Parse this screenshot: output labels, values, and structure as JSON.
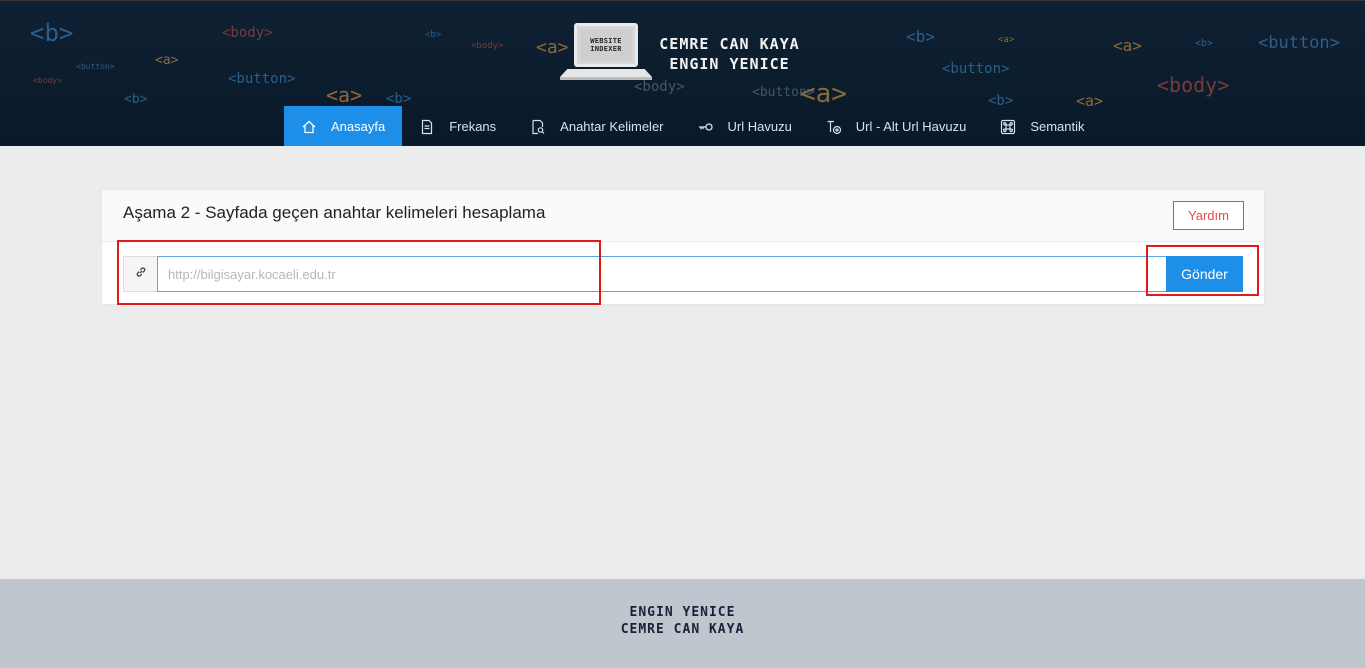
{
  "header": {
    "logo_text": [
      "WEBSITE",
      "INDEXER"
    ],
    "brand_line1": "CEMRE CAN KAYA",
    "brand_line2": "ENGIN YENICE",
    "background_tags": [
      "<b>",
      "<body>",
      "<button>",
      "<a>",
      "<b>",
      "<body>",
      "<a>",
      "<b>",
      "<button>",
      "<body>",
      "<a>",
      "<b>",
      "<button>",
      "<a>",
      "<body>",
      "<b>",
      "<a>",
      "<button>",
      "<b>",
      "<a>",
      "<body>",
      "<a>"
    ]
  },
  "nav": {
    "items": [
      {
        "label": "Anasayfa",
        "icon": "home-icon",
        "active": true
      },
      {
        "label": "Frekans",
        "icon": "document-icon",
        "active": false
      },
      {
        "label": "Anahtar Kelimeler",
        "icon": "document-search-icon",
        "active": false
      },
      {
        "label": "Url Havuzu",
        "icon": "key-icon",
        "active": false
      },
      {
        "label": "Url - Alt Url Havuzu",
        "icon": "tree-add-icon",
        "active": false
      },
      {
        "label": "Semantik",
        "icon": "command-icon",
        "active": false
      }
    ],
    "active_color": "#1e8fe8"
  },
  "card": {
    "title": "Aşama 2 - Sayfada geçen anahtar kelimeleri hesaplama",
    "help_label": "Yardım",
    "url_input": {
      "value": "",
      "placeholder": "http://bilgisayar.kocaeli.edu.tr"
    },
    "submit_label": "Gönder",
    "link_icon": "link-icon"
  },
  "footer": {
    "line1": "ENGIN YENICE",
    "line2": "CEMRE CAN KAYA"
  },
  "colors": {
    "header_bg": "#0b1c2d",
    "accent": "#1e8fe8",
    "danger": "#e24a4a",
    "page_bg": "#ececec",
    "footer_bg": "#bfc6cd",
    "annotation": "#e21a1a"
  }
}
